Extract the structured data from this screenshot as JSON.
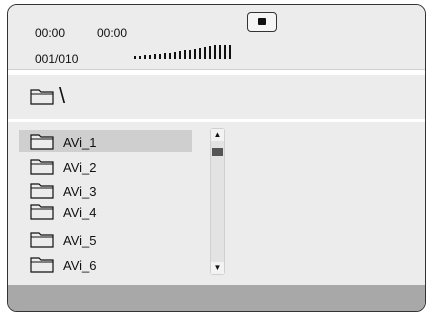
{
  "status": {
    "elapsed_time": "00:00",
    "total_time": "00:00",
    "track_counter": "001/010",
    "level_meter_icon": "volume-level-bars",
    "stop_button_icon": "stop-icon"
  },
  "path_bar": {
    "folder_icon": "folder-icon",
    "current_path": "\\"
  },
  "file_list": {
    "items": [
      {
        "label": "AVi_1",
        "icon": "folder-icon",
        "selected": true
      },
      {
        "label": "AVi_2",
        "icon": "folder-icon",
        "selected": false
      },
      {
        "label": "AVi_3",
        "icon": "folder-icon",
        "selected": false
      },
      {
        "label": "AVi_4",
        "icon": "folder-icon",
        "selected": false
      },
      {
        "label": "AVi_5",
        "icon": "folder-icon",
        "selected": false
      },
      {
        "label": "AVi_6",
        "icon": "folder-icon",
        "selected": false
      }
    ],
    "scroll_up_glyph": "▲",
    "scroll_down_glyph": "▼"
  },
  "colors": {
    "panel_background": "#ececec",
    "selected_row": "#cfcfcf",
    "bottom_bar": "#a8a8a8"
  }
}
